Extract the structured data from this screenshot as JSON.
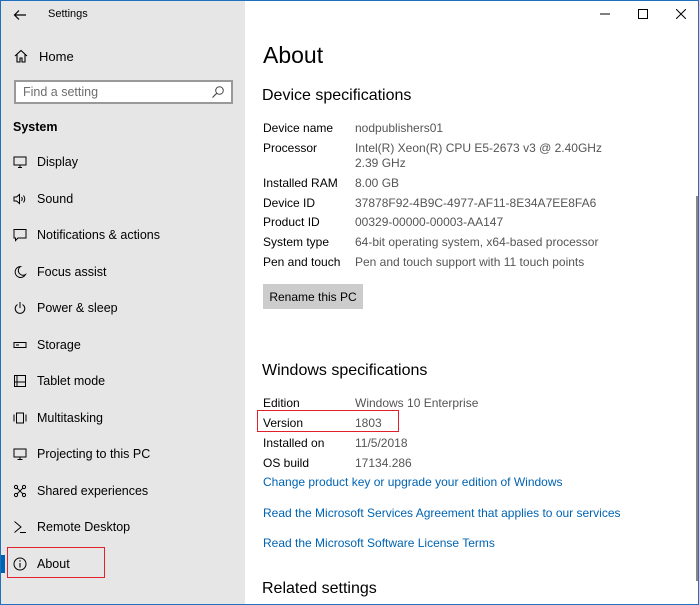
{
  "window": {
    "title": "Settings",
    "controls": [
      "minimize",
      "maximize",
      "close"
    ]
  },
  "sidebar": {
    "home_label": "Home",
    "search_placeholder": "Find a setting",
    "section": "System",
    "items": [
      {
        "label": "Display",
        "icon": "display-icon"
      },
      {
        "label": "Sound",
        "icon": "sound-icon"
      },
      {
        "label": "Notifications & actions",
        "icon": "notifications-icon"
      },
      {
        "label": "Focus assist",
        "icon": "focus-assist-icon"
      },
      {
        "label": "Power & sleep",
        "icon": "power-icon"
      },
      {
        "label": "Storage",
        "icon": "storage-icon"
      },
      {
        "label": "Tablet mode",
        "icon": "tablet-mode-icon"
      },
      {
        "label": "Multitasking",
        "icon": "multitasking-icon"
      },
      {
        "label": "Projecting to this PC",
        "icon": "projecting-icon"
      },
      {
        "label": "Shared experiences",
        "icon": "shared-experiences-icon"
      },
      {
        "label": "Remote Desktop",
        "icon": "remote-desktop-icon"
      },
      {
        "label": "About",
        "icon": "info-icon",
        "active": true
      }
    ]
  },
  "main": {
    "title": "About",
    "device_specs": {
      "heading": "Device specifications",
      "rows": [
        {
          "key": "Device name",
          "value": "nodpublishers01"
        },
        {
          "key": "Processor",
          "value": "Intel(R) Xeon(R) CPU E5-2673 v3 @ 2.40GHz",
          "value2": "2.39 GHz"
        },
        {
          "key": "Installed RAM",
          "value": "8.00 GB"
        },
        {
          "key": "Device ID",
          "value": "37878F92-4B9C-4977-AF11-8E34A7EE8FA6"
        },
        {
          "key": "Product ID",
          "value": "00329-00000-00003-AA147"
        },
        {
          "key": "System type",
          "value": "64-bit operating system, x64-based processor"
        },
        {
          "key": "Pen and touch",
          "value": "Pen and touch support with 11 touch points"
        }
      ],
      "rename_button": "Rename this PC"
    },
    "windows_specs": {
      "heading": "Windows specifications",
      "rows": [
        {
          "key": "Edition",
          "value": "Windows 10 Enterprise"
        },
        {
          "key": "Version",
          "value": "1803"
        },
        {
          "key": "Installed on",
          "value": "11/5/2018"
        },
        {
          "key": "OS build",
          "value": "17134.286"
        }
      ],
      "links": [
        "Change product key or upgrade your edition of Windows",
        "Read the Microsoft Services Agreement that applies to our services",
        "Read the Microsoft Software License Terms"
      ]
    },
    "related_heading": "Related settings"
  },
  "colors": {
    "accent": "#0063b1",
    "highlight": "#e0202b",
    "sidebar_bg": "#e6e6e6",
    "value_text": "#555555"
  }
}
